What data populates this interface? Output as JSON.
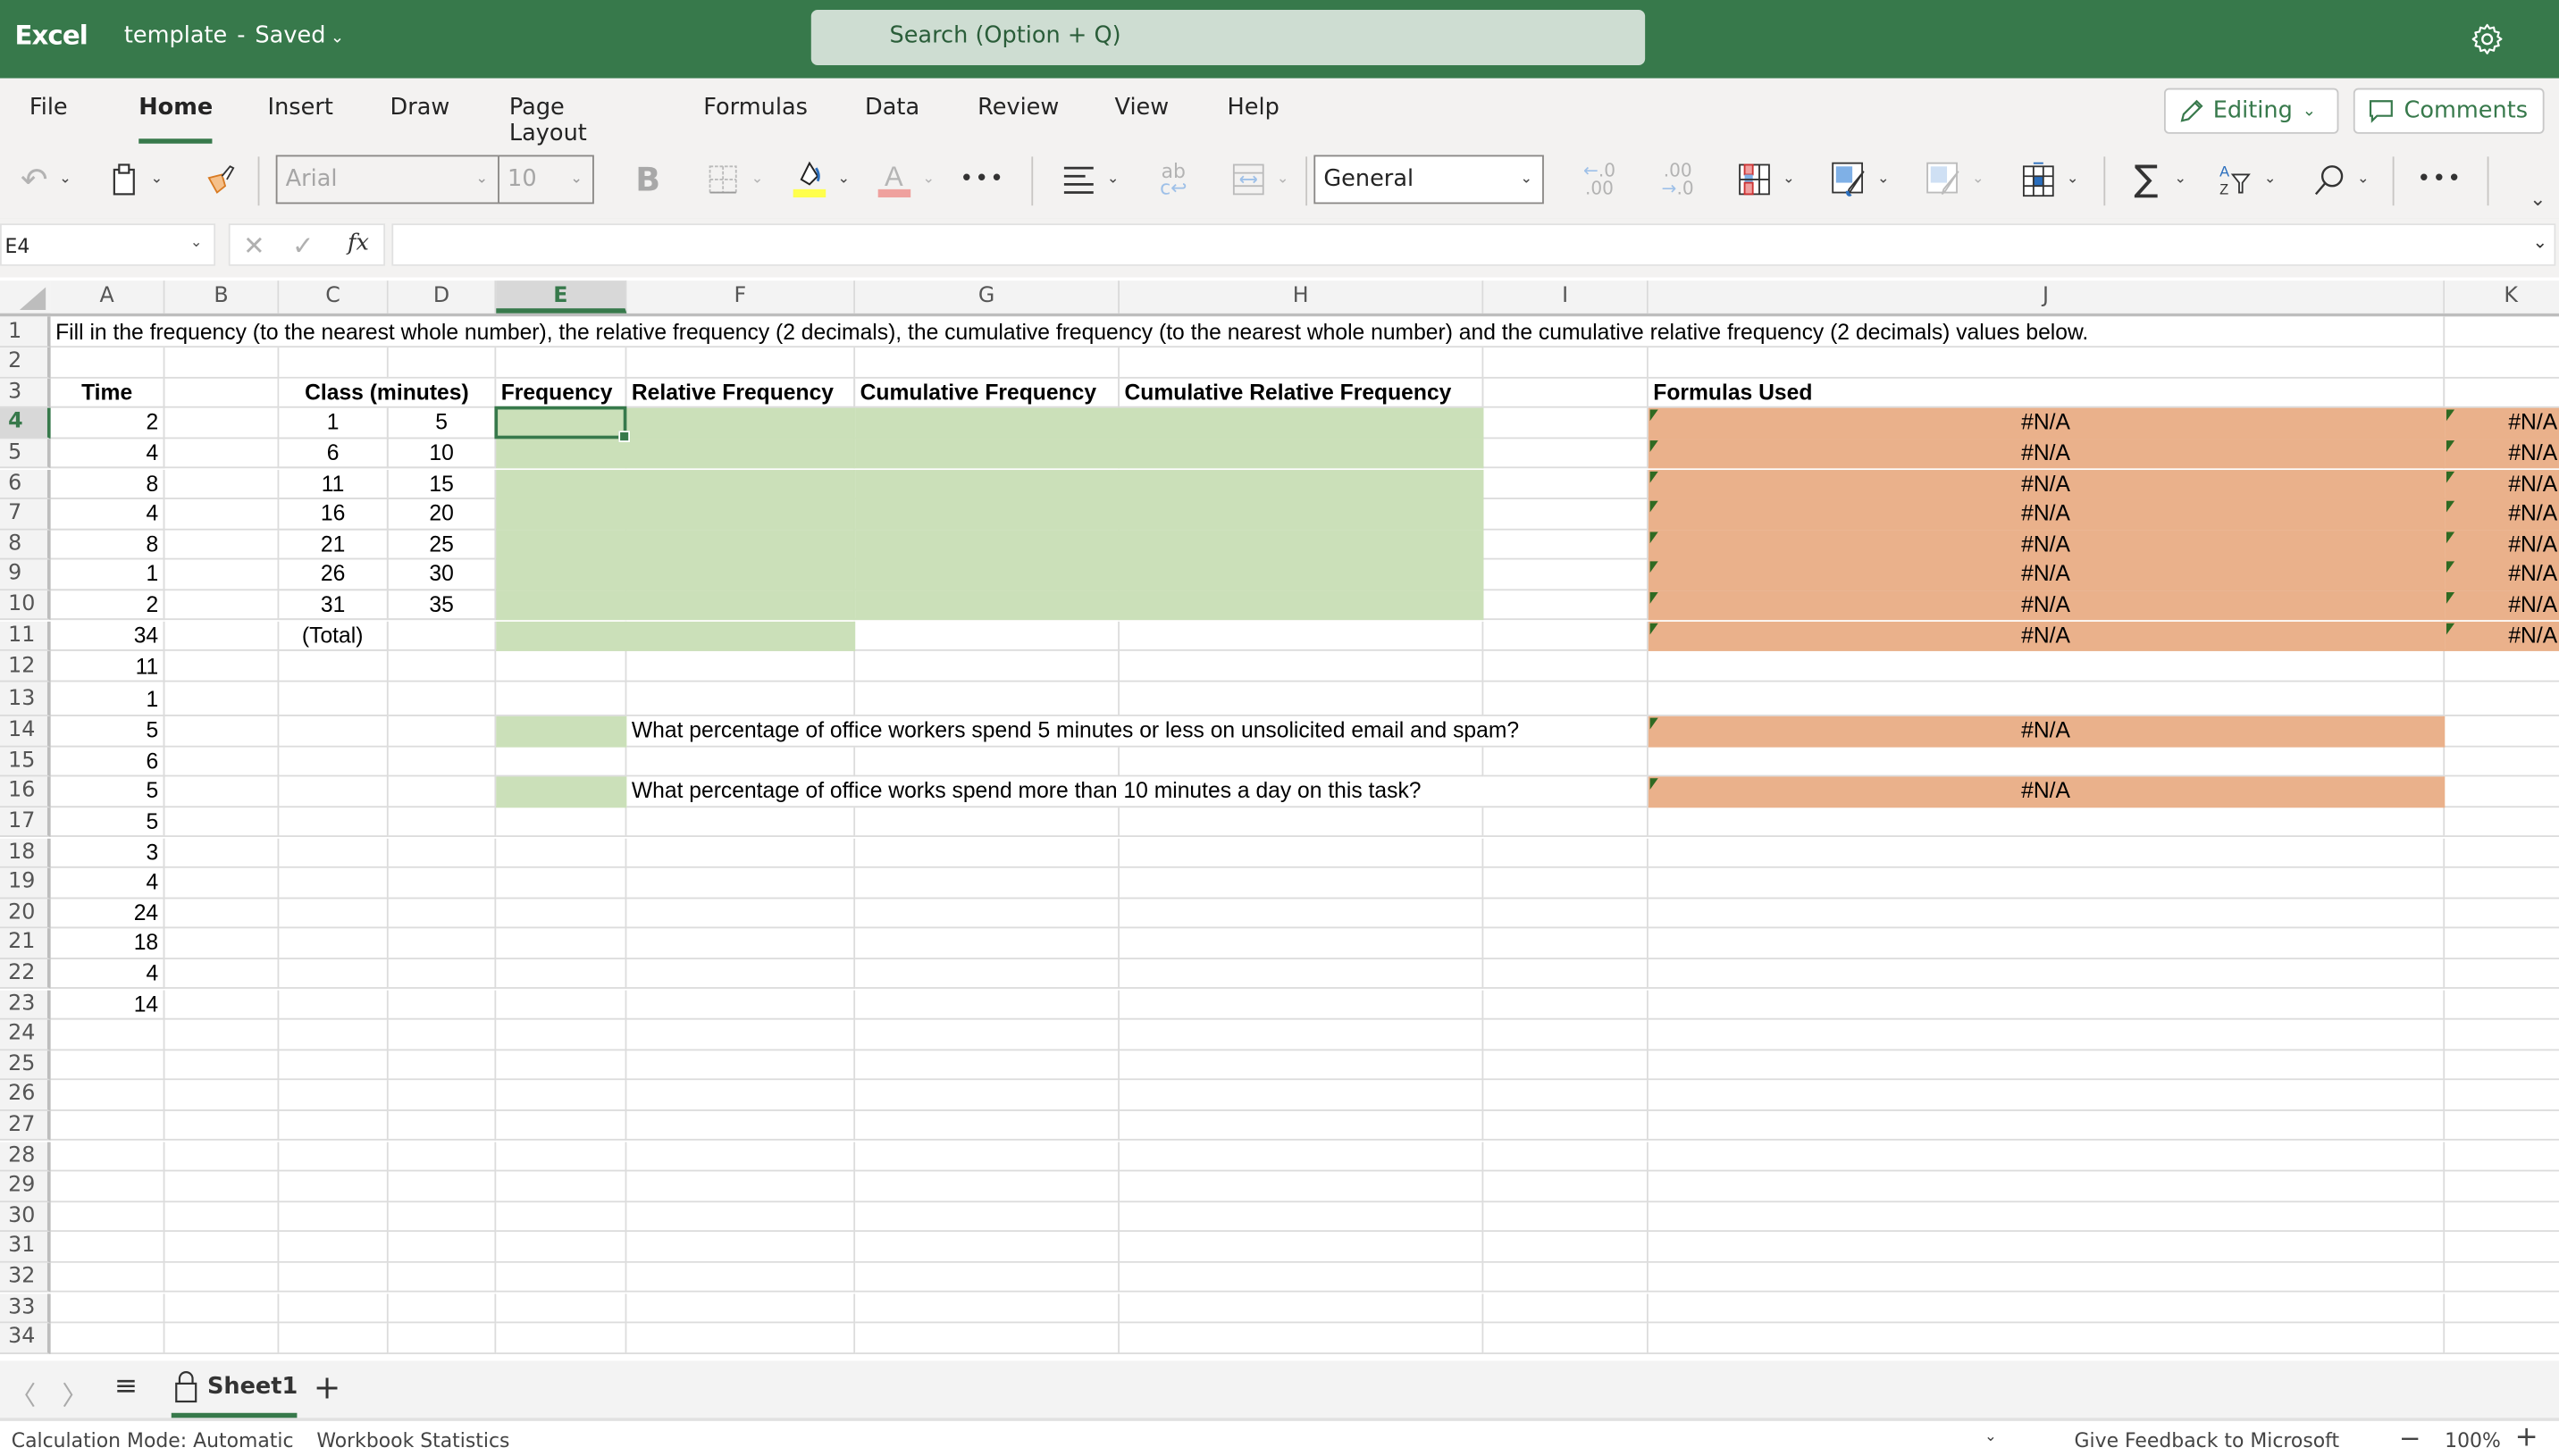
{
  "titlebar": {
    "app_name": "Excel",
    "doc_name": "template",
    "separator": "-",
    "save_status": "Saved",
    "search_placeholder": "Search (Option + Q)",
    "settings_icon": "gear-icon"
  },
  "ribbon": {
    "tabs": [
      "File",
      "Home",
      "Insert",
      "Draw",
      "Page Layout",
      "Formulas",
      "Data",
      "Review",
      "View",
      "Help"
    ],
    "active_tab": "Home",
    "editing_label": "Editing",
    "comments_label": "Comments",
    "font_name": "Arial",
    "font_size": "10",
    "bold_label": "B",
    "number_format": "General",
    "more_label": "•••",
    "icons": [
      "undo-icon",
      "paste-icon",
      "format-painter-icon",
      "bold-icon",
      "borders-icon",
      "fill-color-icon",
      "font-color-icon",
      "more-icon",
      "align-icon",
      "wrap-text-icon",
      "merge-icon",
      "increase-decimal-icon",
      "decrease-decimal-icon",
      "conditional-formatting-icon",
      "format-as-table-icon",
      "cell-styles-icon",
      "insert-cells-icon",
      "autosum-icon",
      "sort-filter-icon",
      "find-icon",
      "more-icon",
      "expand-ribbon-icon"
    ],
    "colors": {
      "fill_color": "#FFFF4D",
      "font_color": "#EFA19E"
    }
  },
  "formula_bar": {
    "name_box": "E4",
    "fx_label": "fx",
    "formula_value": ""
  },
  "grid": {
    "columns": [
      "A",
      "B",
      "C",
      "D",
      "E",
      "F",
      "G",
      "H",
      "I",
      "J",
      "K"
    ],
    "selected_column": "E",
    "selected_row": "4",
    "row_numbers": [
      "1",
      "2",
      "3",
      "4",
      "5",
      "6",
      "7",
      "8",
      "9",
      "10",
      "11",
      "12",
      "13",
      "14",
      "15",
      "16",
      "17",
      "18",
      "19",
      "20",
      "21",
      "22",
      "23",
      "24",
      "25",
      "26",
      "27",
      "28",
      "29",
      "30",
      "31",
      "32",
      "33",
      "34"
    ],
    "instructions": "Fill in the frequency (to the nearest whole number), the relative frequency (2 decimals), the cumulative frequency (to the nearest whole number) and the cumulative relative frequency (2 decimals) values below.",
    "headers": {
      "time": "Time",
      "class": "Class (minutes)",
      "frequency": "Frequency",
      "relative_frequency": "Relative Frequency",
      "cumulative_frequency": "Cumulative Frequency",
      "cumulative_relative_frequency": "Cumulative Relative Frequency",
      "formulas_used": "Formulas Used"
    },
    "time_values": [
      "2",
      "4",
      "8",
      "4",
      "8",
      "1",
      "2",
      "34",
      "11",
      "1",
      "5",
      "6",
      "5",
      "5",
      "3",
      "4",
      "24",
      "18",
      "4",
      "14"
    ],
    "classes": [
      {
        "low": "1",
        "high": "5"
      },
      {
        "low": "6",
        "high": "10"
      },
      {
        "low": "11",
        "high": "15"
      },
      {
        "low": "16",
        "high": "20"
      },
      {
        "low": "21",
        "high": "25"
      },
      {
        "low": "26",
        "high": "30"
      },
      {
        "low": "31",
        "high": "35"
      }
    ],
    "total_label": "(Total)",
    "formula_results_j": [
      "#N/A",
      "#N/A",
      "#N/A",
      "#N/A",
      "#N/A",
      "#N/A",
      "#N/A",
      "#N/A"
    ],
    "formula_results_k": [
      "#N/A",
      "#N/A",
      "#N/A",
      "#N/A",
      "#N/A",
      "#N/A",
      "#N/A",
      "#N/A"
    ],
    "question_1": "What percentage of office workers spend 5 minutes or less on unsolicited email and spam?",
    "question_1_result": "#N/A",
    "question_2": "What percentage of office works spend more than 10 minutes a day on this task?",
    "question_2_result": "#N/A",
    "colors": {
      "input_fill": "#CBE0B9",
      "formula_fill": "#EAB18B",
      "error_indicator": "#2F6A22"
    }
  },
  "sheet_tabs": {
    "sheets": [
      "Sheet1"
    ],
    "active_sheet": "Sheet1",
    "add_sheet_label": "+"
  },
  "status_bar": {
    "calc_mode": "Calculation Mode: Automatic",
    "workbook_stats": "Workbook Statistics",
    "feedback": "Give Feedback to Microsoft",
    "zoom_level": "100%",
    "zoom_out": "−",
    "zoom_in": "+"
  },
  "brand_color": "#37794B"
}
